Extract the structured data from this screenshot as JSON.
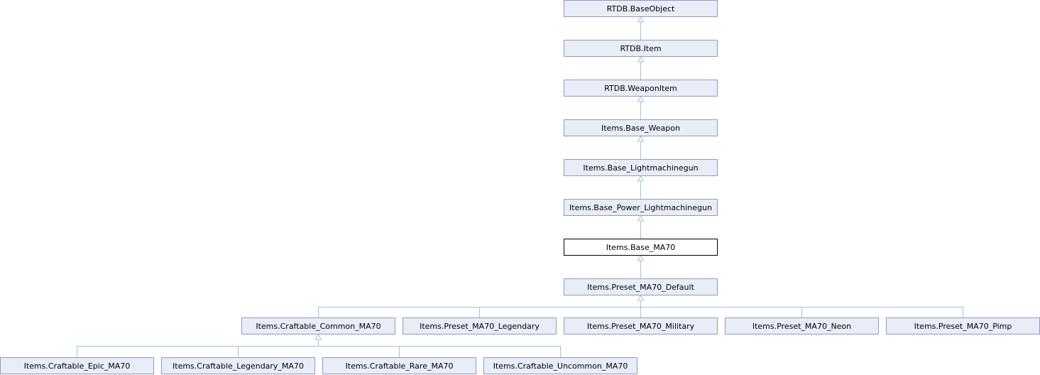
{
  "diagram": {
    "type": "class-inheritance",
    "nodes": [
      {
        "id": "base_object",
        "label": "RTDB.BaseObject"
      },
      {
        "id": "item",
        "label": "RTDB.Item"
      },
      {
        "id": "weapon_item",
        "label": "RTDB.WeaponItem"
      },
      {
        "id": "base_weapon",
        "label": "Items.Base_Weapon"
      },
      {
        "id": "base_lmg",
        "label": "Items.Base_Lightmachinegun"
      },
      {
        "id": "base_power_lmg",
        "label": "Items.Base_Power_Lightmachinegun"
      },
      {
        "id": "base_ma70",
        "label": "Items.Base_MA70",
        "current": true
      },
      {
        "id": "preset_default",
        "label": "Items.Preset_MA70_Default"
      },
      {
        "id": "craftable_common",
        "label": "Items.Craftable_Common_MA70"
      },
      {
        "id": "preset_legendary",
        "label": "Items.Preset_MA70_Legendary"
      },
      {
        "id": "preset_military",
        "label": "Items.Preset_MA70_Military"
      },
      {
        "id": "preset_neon",
        "label": "Items.Preset_MA70_Neon"
      },
      {
        "id": "preset_pimp",
        "label": "Items.Preset_MA70_Pimp"
      },
      {
        "id": "craftable_epic",
        "label": "Items.Craftable_Epic_MA70"
      },
      {
        "id": "craftable_legendary",
        "label": "Items.Craftable_Legendary_MA70"
      },
      {
        "id": "craftable_rare",
        "label": "Items.Craftable_Rare_MA70"
      },
      {
        "id": "craftable_uncommon",
        "label": "Items.Craftable_Uncommon_MA70"
      }
    ],
    "edges": [
      {
        "child": "item",
        "parent": "base_object"
      },
      {
        "child": "weapon_item",
        "parent": "item"
      },
      {
        "child": "base_weapon",
        "parent": "weapon_item"
      },
      {
        "child": "base_lmg",
        "parent": "base_weapon"
      },
      {
        "child": "base_power_lmg",
        "parent": "base_lmg"
      },
      {
        "child": "base_ma70",
        "parent": "base_power_lmg"
      },
      {
        "child": "preset_default",
        "parent": "base_ma70"
      },
      {
        "child": "craftable_common",
        "parent": "preset_default"
      },
      {
        "child": "preset_legendary",
        "parent": "preset_default"
      },
      {
        "child": "preset_military",
        "parent": "preset_default"
      },
      {
        "child": "preset_neon",
        "parent": "preset_default"
      },
      {
        "child": "preset_pimp",
        "parent": "preset_default"
      },
      {
        "child": "craftable_epic",
        "parent": "craftable_common"
      },
      {
        "child": "craftable_legendary",
        "parent": "craftable_common"
      },
      {
        "child": "craftable_rare",
        "parent": "craftable_common"
      },
      {
        "child": "craftable_uncommon",
        "parent": "craftable_common"
      }
    ],
    "colors": {
      "node_fill": "#e9edf7",
      "node_border": "#8c9bbf",
      "current_fill": "#ffffff",
      "current_border": "#000000",
      "edge": "#9ec4dc"
    }
  }
}
